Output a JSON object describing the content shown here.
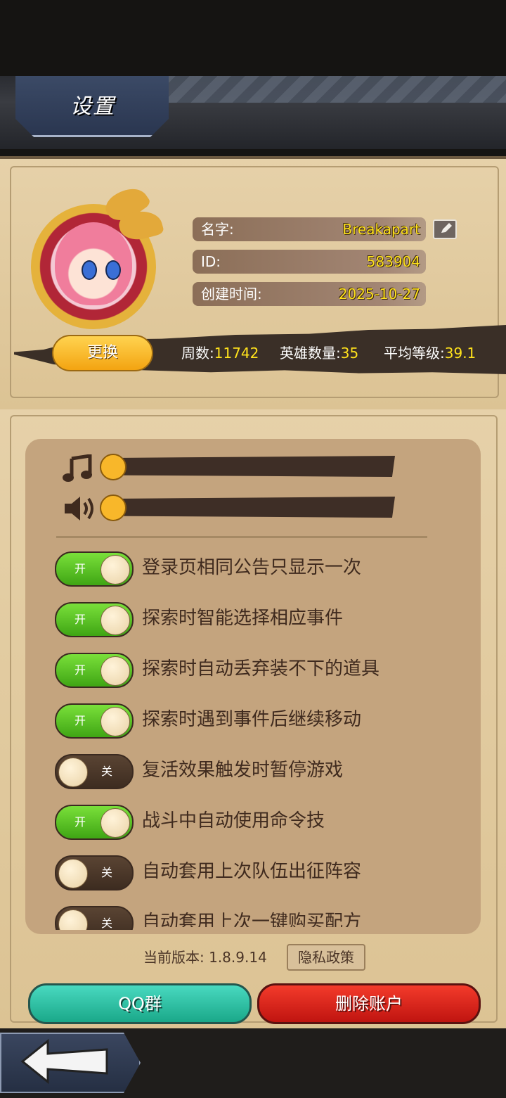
{
  "header": {
    "title": "设置"
  },
  "profile": {
    "name_label": "名字:",
    "name_value": "Breakapart",
    "id_label": "ID:",
    "id_value": "583904",
    "created_label": "创建时间:",
    "created_value": "2025-10-27",
    "change_button": "更换",
    "stats": {
      "weeks_label": "周数:",
      "weeks_value": "11742",
      "heroes_label": "英雄数量:",
      "heroes_value": "35",
      "avg_label": "平均等级:",
      "avg_value": "39.1"
    }
  },
  "audio": {
    "music_level": 0,
    "sound_level": 0
  },
  "toggles": [
    {
      "state": "开",
      "on": true,
      "label": "登录页相同公告只显示一次"
    },
    {
      "state": "开",
      "on": true,
      "label": "探索时智能选择相应事件"
    },
    {
      "state": "开",
      "on": true,
      "label": "探索时自动丢弃装不下的道具"
    },
    {
      "state": "开",
      "on": true,
      "label": "探索时遇到事件后继续移动"
    },
    {
      "state": "关",
      "on": false,
      "label": "复活效果触发时暂停游戏"
    },
    {
      "state": "开",
      "on": true,
      "label": "战斗中自动使用命令技"
    },
    {
      "state": "关",
      "on": false,
      "label": "自动套用上次队伍出征阵容"
    },
    {
      "state": "关",
      "on": false,
      "label": "自动套用上次一键购买配方"
    }
  ],
  "footer": {
    "version": "当前版本: 1.8.9.14",
    "privacy": "隐私政策",
    "qq_button": "QQ群",
    "delete_button": "删除账户"
  },
  "colors": {
    "accent_yellow": "#ffe21c",
    "toggle_on": "#5cc426",
    "delete_red": "#e0261e",
    "qq_teal": "#2fc4a6"
  }
}
